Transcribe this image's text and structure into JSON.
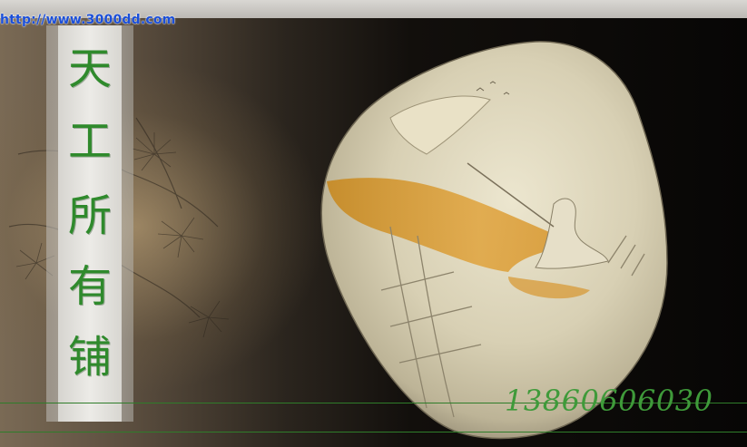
{
  "header": {
    "url_text": "http://www.3000dd.com"
  },
  "banner": {
    "characters": [
      "天",
      "工",
      "所",
      "有",
      "铺"
    ]
  },
  "contact": {
    "phone": "13860606030"
  },
  "colors": {
    "calligraphy_green": "#2f8a2c",
    "url_blue": "#1b4fd8",
    "background": "#0c0b09"
  },
  "illustration": {
    "subject": "carved-stone-with-fisherman-scene",
    "background_motif": "ink-pine-branches"
  }
}
